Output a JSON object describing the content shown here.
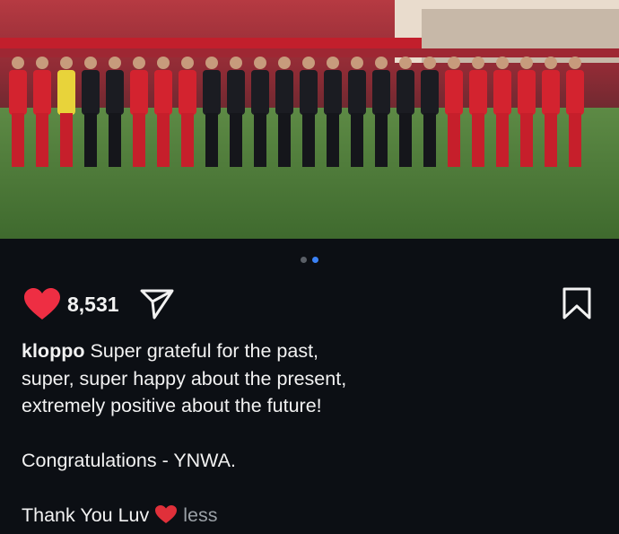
{
  "post": {
    "image_alt_icon": "team-celebration-photo",
    "carousel": {
      "count": 2,
      "active_index": 1
    },
    "like_count": "8,531",
    "username": "kloppo",
    "caption_line1": "Super grateful for the past,",
    "caption_line2": "super, super happy about the present,",
    "caption_line3": "extremely positive about the future!",
    "caption_line4": "Congratulations - YNWA.",
    "caption_line5": "Thank You Luv",
    "less_label": "less"
  },
  "colors": {
    "background": "#0c0f14",
    "like_red": "#ee2e43",
    "carousel_active": "#3b82f6",
    "muted_text": "#9aa0a6"
  },
  "icons": {
    "like": "heart-icon",
    "share": "send-icon",
    "save": "bookmark-icon",
    "emoji": "red-heart-emoji"
  }
}
